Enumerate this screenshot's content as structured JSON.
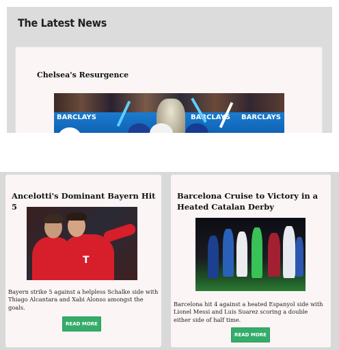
{
  "section": {
    "title": "The Latest News"
  },
  "featured": {
    "title": "Chelsea's Resurgence",
    "image_icon": "trophy-celebration-photo",
    "board_text": [
      "BARCLAYS",
      "BARCLAYS",
      "BARCLAYS"
    ]
  },
  "articles": [
    {
      "title": "Ancelotti's Dominant Bayern Hit 5",
      "image_icon": "bayern-players-photo",
      "excerpt": "Bayern strike 5 against a helpless Schalke side with Thiago Alcantara and Xabi Alonso amongst the goals.",
      "button_label": "READ MORE",
      "logo_text": "T"
    },
    {
      "title": "Barcelona Cruise to Victory in a Heated Catalan Derby",
      "image_icon": "barcelona-espanyol-photo",
      "excerpt": "Barcelona hit 4 against a heated Espanyol side with Lionel Messi and Luis Suarez scoring a double either side of half time.",
      "button_label": "READ MORE"
    }
  ],
  "colors": {
    "button": "#35ac6a",
    "panel": "#dcdcdc",
    "card": "#fbf5f5"
  }
}
